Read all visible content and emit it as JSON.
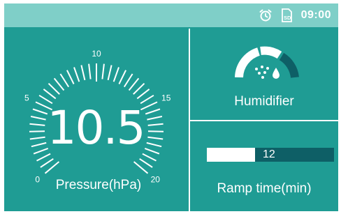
{
  "status_bar": {
    "icons": [
      "alarm-clock-icon",
      "sd-card-icon"
    ],
    "sd_text": "SD",
    "time": "09:00"
  },
  "pressure": {
    "value": "10.5",
    "label": "Pressure(hPa)",
    "scale_min": 0,
    "scale_max": 20,
    "tick_labels": [
      "0",
      "5",
      "10",
      "15",
      "20"
    ]
  },
  "humidifier": {
    "label": "Humidifier",
    "icon": "humidifier-icon",
    "level_segments": 3,
    "active_segments": 2
  },
  "ramp": {
    "value": "12",
    "label": "Ramp time(min)",
    "fill_fraction": 0.38
  },
  "colors": {
    "background": "#1f9c94",
    "status_bar": "#7fcfc8",
    "dark_accent": "#0e5f66",
    "foreground": "#ffffff"
  }
}
